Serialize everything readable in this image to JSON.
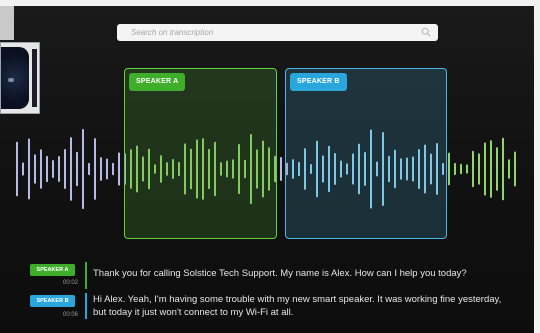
{
  "search": {
    "placeholder": "Search on transcription",
    "icon": "search-icon"
  },
  "panes": [
    {
      "label": "SPEAKER A",
      "color": "#3fae2a"
    },
    {
      "label": "SPEAKER B",
      "color": "#29a6dc"
    }
  ],
  "transcript": [
    {
      "speaker": "SPEAKER A",
      "time": "00:02",
      "text": "Thank you for calling Solstice Tech Support. My name is Alex. How can I help you today?"
    },
    {
      "speaker": "SPEAKER B",
      "time": "00:06",
      "text": "Hi Alex. Yeah, I'm having some trouble with my new smart speaker. It was working fine yesterday, but today it just won't connect to my Wi-Fi at all."
    }
  ],
  "colors": {
    "speaker_a": "#3fae2a",
    "speaker_b": "#29a6dc",
    "wave_neutral": "#b9b9e6",
    "wave_a": "#8fd56a",
    "wave_b": "#8fd4ef"
  }
}
